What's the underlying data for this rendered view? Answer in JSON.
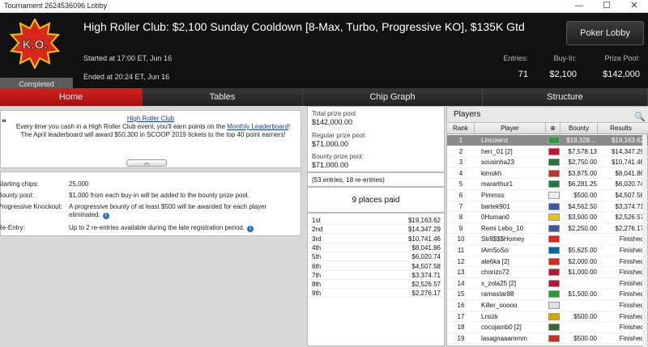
{
  "window": {
    "title": "Tournament 2624536096 Lobby",
    "controls": [
      "—",
      "☐",
      "✕"
    ]
  },
  "header": {
    "logo_text": "K.O.",
    "status": "Completed",
    "title": "High Roller Club: $2,100 Sunday Cooldown [8-Max, Turbo, Progressive KO], $135K Gtd",
    "started": "Started at 17:00 ET, Jun 16",
    "ended": "Ended at 20:24 ET, Jun 16",
    "lobby_button": "Poker Lobby",
    "stats": [
      {
        "label": "Entries:",
        "value": "71"
      },
      {
        "label": "Buy-In:",
        "value": "$2,100"
      },
      {
        "label": "Prize Pool:",
        "value": "$142,000"
      }
    ]
  },
  "tabs": [
    "Home",
    "Tables",
    "Chip Graph",
    "Structure"
  ],
  "promo": {
    "title": "High Roller Club",
    "text_before": "Every time you cash in a High Roller Club event, you'll earn points on the ",
    "link": "Monthly Leaderboard",
    "text_after": "! The April leaderboard will award $50,300 in SCOOP 2019 tickets to the top 40 point earners!"
  },
  "details": [
    {
      "key": "Starting chips:",
      "value": "25,000"
    },
    {
      "key": "Bounty pool:",
      "value": "$1,000 from each buy-in will be added to the bounty prize pool."
    },
    {
      "key": "Progressive Knockout:",
      "value": "A progressive bounty of at least $500 will be awarded for each player eliminated."
    },
    {
      "key": "Re-Entry:",
      "value": "Up to 2 re-entries available during the late registration period."
    }
  ],
  "prize_box": {
    "total_label": "Total prize pool:",
    "total": "$142,000.00",
    "regular_label": "Regular prize pool:",
    "regular": "$71,000.00",
    "bounty_label": "Bounty prize pool:",
    "bounty": "$71,000.00"
  },
  "entries_note": "(53 entries, 18 re-entries)",
  "places_paid": "9 places paid",
  "payouts": [
    {
      "place": "1st",
      "amount": "$19,163.62"
    },
    {
      "place": "2nd",
      "amount": "$14,347.29"
    },
    {
      "place": "3rd",
      "amount": "$10,741.46"
    },
    {
      "place": "4th",
      "amount": "$8,041.86"
    },
    {
      "place": "5th",
      "amount": "$6,020.74"
    },
    {
      "place": "6th",
      "amount": "$4,507.58"
    },
    {
      "place": "7th",
      "amount": "$3,374.71"
    },
    {
      "place": "8th",
      "amount": "$2,526.57"
    },
    {
      "place": "9th",
      "amount": "$2,276.17"
    }
  ],
  "players_panel": {
    "title": "Players",
    "columns": [
      "Rank",
      "Player",
      "",
      "Bounty",
      "Results"
    ],
    "rows": [
      {
        "rank": "1",
        "name": "Lincownz",
        "bounty": "$19,328....",
        "result": "$19,163.62",
        "flag": "#2a9a3a"
      },
      {
        "rank": "2",
        "name": "herr_01 [2]",
        "bounty": "$7,578.13",
        "result": "$14,347.29",
        "flag": "#c8102e"
      },
      {
        "rank": "3",
        "name": "sousinha23",
        "bounty": "$2,750.00",
        "result": "$10,741.46",
        "flag": "#1f7a3a"
      },
      {
        "rank": "4",
        "name": "kimokh",
        "bounty": "$3,875.00",
        "result": "$8,041.86",
        "flag": "#d52b1e"
      },
      {
        "rank": "5",
        "name": "mararthur1",
        "bounty": "$6,281.25",
        "result": "$6,020.74",
        "flag": "#1f7a3a"
      },
      {
        "rank": "6",
        "name": "Pimmss",
        "bounty": "$500.00",
        "result": "$4,507.58",
        "flag": "#f0f0f0"
      },
      {
        "rank": "7",
        "name": "bartek901",
        "bounty": "$4,562.50",
        "result": "$3,374.71",
        "flag": "#3b5ba5"
      },
      {
        "rank": "8",
        "name": "0Human0",
        "bounty": "$3,500.00",
        "result": "$2,526.57",
        "flag": "#f2c300"
      },
      {
        "rank": "9",
        "name": "Remi Lebo_10",
        "bounty": "$2,250.00",
        "result": "$2,276.17",
        "flag": "#3b5ba5"
      },
      {
        "rank": "10",
        "name": "Str8$$$Homey",
        "bounty": "",
        "result": "Finished",
        "flag": "#d52b1e"
      },
      {
        "rank": "11",
        "name": "IAmSoSo",
        "bounty": "$5,625.00",
        "result": "Finished",
        "flag": "#006aa7"
      },
      {
        "rank": "12",
        "name": "ale6ka [2]",
        "bounty": "$2,000.00",
        "result": "Finished",
        "flag": "#d52b1e"
      },
      {
        "rank": "13",
        "name": "chorizo72",
        "bounty": "$1,000.00",
        "result": "Finished",
        "flag": "#c8102e"
      },
      {
        "rank": "14",
        "name": "x_zola25 [2]",
        "bounty": "",
        "result": "Finished",
        "flag": "#c8102e"
      },
      {
        "rank": "15",
        "name": "ramastar88",
        "bounty": "$1,500.00",
        "result": "Finished",
        "flag": "#2a9a3a"
      },
      {
        "rank": "16",
        "name": "Killer_ooooo",
        "bounty": "",
        "result": "Finished",
        "flag": "#e0e0e0"
      },
      {
        "rank": "17",
        "name": "Lrsizk",
        "bounty": "$500.00",
        "result": "Finished",
        "flag": "#d8a400"
      },
      {
        "rank": "18",
        "name": "cocojamb0 [2]",
        "bounty": "",
        "result": "Finished",
        "flag": "#3a6a2a"
      },
      {
        "rank": "19",
        "name": "lasagnaaammm",
        "bounty": "$500.00",
        "result": "Finished",
        "flag": "#d52b1e"
      }
    ]
  }
}
